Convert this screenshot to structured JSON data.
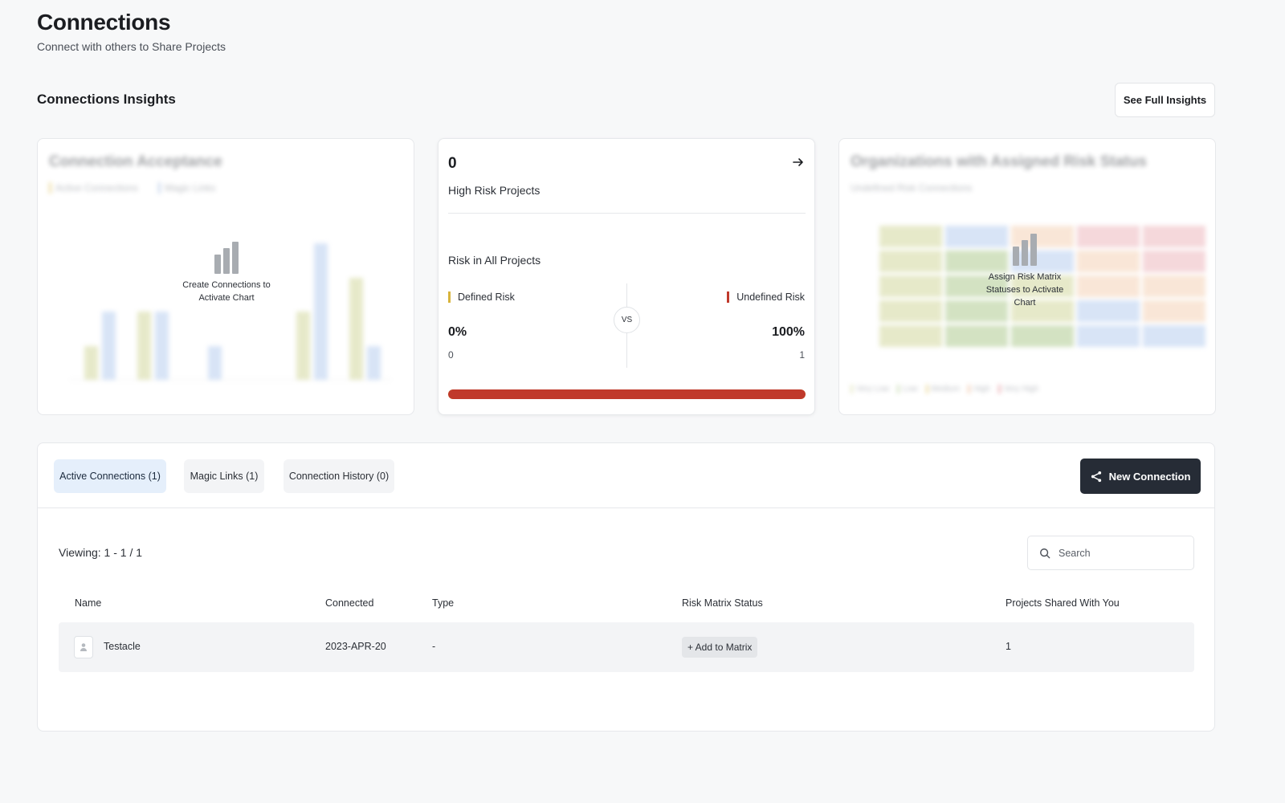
{
  "header": {
    "title": "Connections",
    "subtitle": "Connect with others to Share Projects"
  },
  "insights": {
    "section_title": "Connections Insights",
    "see_full_label": "See Full Insights",
    "acceptance_card": {
      "title": "Connection Acceptance",
      "legend": [
        "Active Connections",
        "Magic Links"
      ],
      "overlay_text": "Create Connections to Activate Chart"
    },
    "high_risk_card": {
      "count": "0",
      "label": "High Risk Projects",
      "arrow_icon": "arrow-right-icon",
      "risk_title": "Risk in All Projects",
      "defined": {
        "label": "Defined Risk",
        "percent": "0%",
        "count": "0",
        "color": "#d8b43c"
      },
      "undefined": {
        "label": "Undefined Risk",
        "percent": "100%",
        "count": "1",
        "color": "#c0392b"
      },
      "vs_label": "VS",
      "undefined_fraction": 1.0
    },
    "risk_status_card": {
      "title": "Organizations with Assigned Risk Status",
      "subtitle": "Undefined Risk Connections",
      "overlay_text": "Assign Risk Matrix Statuses to Activate Chart",
      "legend": [
        "Very Low",
        "Low",
        "Medium",
        "High",
        "Very High"
      ]
    }
  },
  "connections": {
    "tabs": [
      {
        "label": "Active Connections (1)",
        "active": true
      },
      {
        "label": "Magic Links (1)",
        "active": false
      },
      {
        "label": "Connection History (0)",
        "active": false
      }
    ],
    "new_connection_label": "New Connection",
    "viewing_text": "Viewing: 1 - 1 / 1",
    "search_placeholder": "Search",
    "columns": [
      "Name",
      "Connected",
      "Type",
      "Risk Matrix Status",
      "Projects Shared With You"
    ],
    "rows": [
      {
        "name": "Testacle",
        "connected": "2023-APR-20",
        "type": "-",
        "risk_action": "+ Add to Matrix",
        "projects_shared": "1"
      }
    ]
  },
  "colors": {
    "accent_dark": "#262c36",
    "tab_active_bg": "#e5effb",
    "risk_red": "#c0392b",
    "risk_yellow": "#d8b43c"
  }
}
